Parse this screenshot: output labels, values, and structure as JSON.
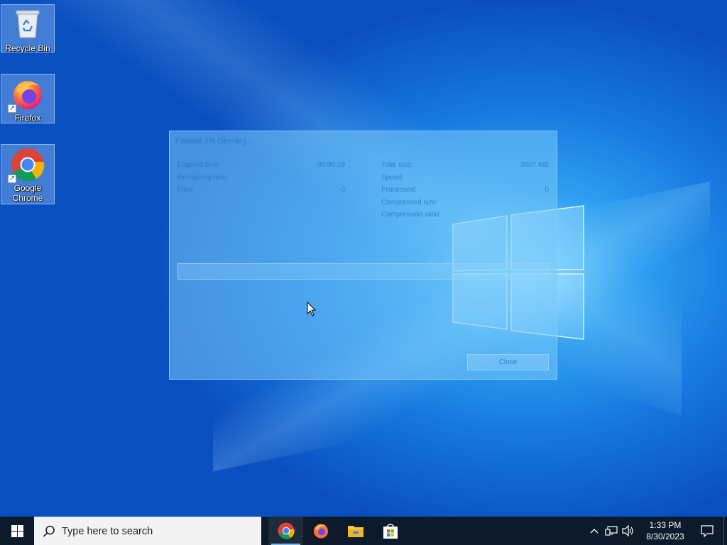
{
  "desktop": {
    "icons": [
      {
        "label": "Recycle Bin",
        "icon": "recycle-bin-icon"
      },
      {
        "label": "Firefox",
        "icon": "firefox-icon"
      },
      {
        "label": "Google Chrome",
        "icon": "chrome-icon"
      }
    ]
  },
  "dialog": {
    "title": "Paused 0% Opening...",
    "progress": 0,
    "left": [
      {
        "label": "Elapsed time:",
        "value": "00:00:18"
      },
      {
        "label": "Remaining time:",
        "value": ""
      },
      {
        "label": "Files:",
        "value": "0"
      }
    ],
    "right": [
      {
        "label": "Total size:",
        "value": "3807 MB"
      },
      {
        "label": "Speed:",
        "value": ""
      },
      {
        "label": "Processed:",
        "value": "0"
      },
      {
        "label": "Compressed size:",
        "value": ""
      },
      {
        "label": "Compression ratio:",
        "value": ""
      }
    ],
    "close_label": "Close"
  },
  "taskbar": {
    "search_placeholder": "Type here to search",
    "apps": [
      "chrome-icon",
      "firefox-icon",
      "file-explorer-icon",
      "microsoft-store-icon"
    ],
    "time": "1:33 PM",
    "date": "8/30/2023"
  },
  "colors": {
    "taskbar": "#0c1a2b",
    "accent": "#76b9ed"
  }
}
